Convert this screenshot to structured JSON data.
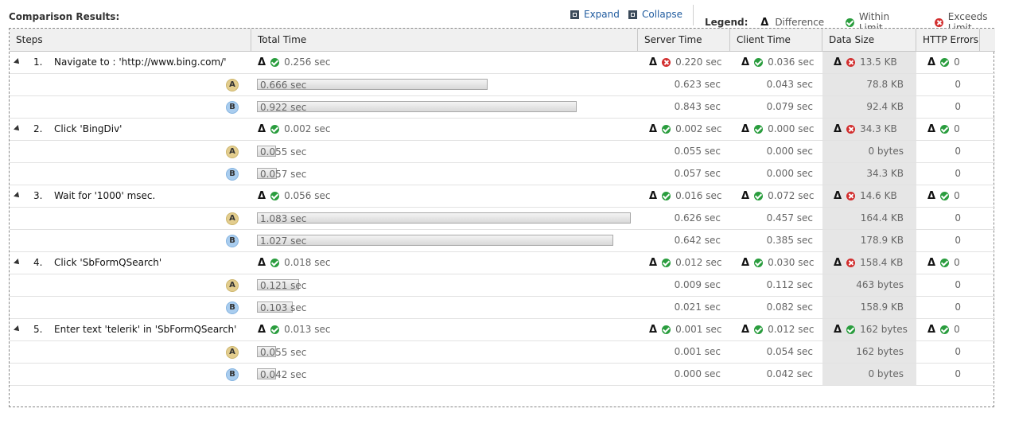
{
  "header": {
    "title": "Comparison Results:",
    "expand_label": "Expand",
    "collapse_label": "Collapse",
    "legend_label": "Legend:",
    "legend_difference": "Difference",
    "legend_within": "Within Limit",
    "legend_exceeds": "Exceeds Limit"
  },
  "columns": {
    "steps": "Steps",
    "total_time": "Total Time",
    "server_time": "Server Time",
    "client_time": "Client Time",
    "data_size": "Data Size",
    "http_errors": "HTTP Errors"
  },
  "delta_symbol": "Δ",
  "steps": [
    {
      "num": "1.",
      "text": "Navigate to : 'http://www.bing.com/'",
      "summary": {
        "total": "0.256 sec",
        "total_status": "ok",
        "server": "0.220 sec",
        "server_status": "err",
        "client": "0.036 sec",
        "client_status": "ok",
        "data": "13.5 KB",
        "data_status": "err",
        "http": "0",
        "http_status": "ok"
      },
      "a": {
        "label": "A",
        "total": "0.666 sec",
        "total_fraction": 0.618,
        "server": "0.623 sec",
        "client": "0.043 sec",
        "data": "78.8 KB",
        "http": "0"
      },
      "b": {
        "label": "B",
        "total": "0.922 sec",
        "total_fraction": 0.855,
        "server": "0.843 sec",
        "client": "0.079 sec",
        "data": "92.4 KB",
        "http": "0"
      }
    },
    {
      "num": "2.",
      "text": "Click 'BingDiv'",
      "summary": {
        "total": "0.002 sec",
        "total_status": "ok",
        "server": "0.002 sec",
        "server_status": "ok",
        "client": "0.000 sec",
        "client_status": "ok",
        "data": "34.3 KB",
        "data_status": "err",
        "http": "0",
        "http_status": "ok"
      },
      "a": {
        "label": "A",
        "total": "0.055 sec",
        "total_fraction": 0.051,
        "server": "0.055 sec",
        "client": "0.000 sec",
        "data": "0 bytes",
        "http": "0"
      },
      "b": {
        "label": "B",
        "total": "0.057 sec",
        "total_fraction": 0.053,
        "server": "0.057 sec",
        "client": "0.000 sec",
        "data": "34.3 KB",
        "http": "0"
      }
    },
    {
      "num": "3.",
      "text": "Wait for '1000' msec.",
      "summary": {
        "total": "0.056 sec",
        "total_status": "ok",
        "server": "0.016 sec",
        "server_status": "ok",
        "client": "0.072 sec",
        "client_status": "ok",
        "data": "14.6 KB",
        "data_status": "err",
        "http": "0",
        "http_status": "ok"
      },
      "a": {
        "label": "A",
        "total": "1.083 sec",
        "total_fraction": 1.0,
        "server": "0.626 sec",
        "client": "0.457 sec",
        "data": "164.4 KB",
        "http": "0"
      },
      "b": {
        "label": "B",
        "total": "1.027 sec",
        "total_fraction": 0.953,
        "server": "0.642 sec",
        "client": "0.385 sec",
        "data": "178.9 KB",
        "http": "0"
      }
    },
    {
      "num": "4.",
      "text": "Click 'SbFormQSearch'",
      "summary": {
        "total": "0.018 sec",
        "total_status": "ok",
        "server": "0.012 sec",
        "server_status": "ok",
        "client": "0.030 sec",
        "client_status": "ok",
        "data": "158.4 KB",
        "data_status": "err",
        "http": "0",
        "http_status": "ok"
      },
      "a": {
        "label": "A",
        "total": "0.121 sec",
        "total_fraction": 0.112,
        "server": "0.009 sec",
        "client": "0.112 sec",
        "data": "463 bytes",
        "http": "0"
      },
      "b": {
        "label": "B",
        "total": "0.103 sec",
        "total_fraction": 0.096,
        "server": "0.021 sec",
        "client": "0.082 sec",
        "data": "158.9 KB",
        "http": "0"
      }
    },
    {
      "num": "5.",
      "text": "Enter text 'telerik' in 'SbFormQSearch'",
      "summary": {
        "total": "0.013 sec",
        "total_status": "ok",
        "server": "0.001 sec",
        "server_status": "ok",
        "client": "0.012 sec",
        "client_status": "ok",
        "data": "162 bytes",
        "data_status": "ok",
        "http": "0",
        "http_status": "ok"
      },
      "a": {
        "label": "A",
        "total": "0.055 sec",
        "total_fraction": 0.051,
        "server": "0.001 sec",
        "client": "0.054 sec",
        "data": "162 bytes",
        "http": "0"
      },
      "b": {
        "label": "B",
        "total": "0.042 sec",
        "total_fraction": 0.039,
        "server": "0.000 sec",
        "client": "0.042 sec",
        "data": "0 bytes",
        "http": "0"
      }
    }
  ]
}
